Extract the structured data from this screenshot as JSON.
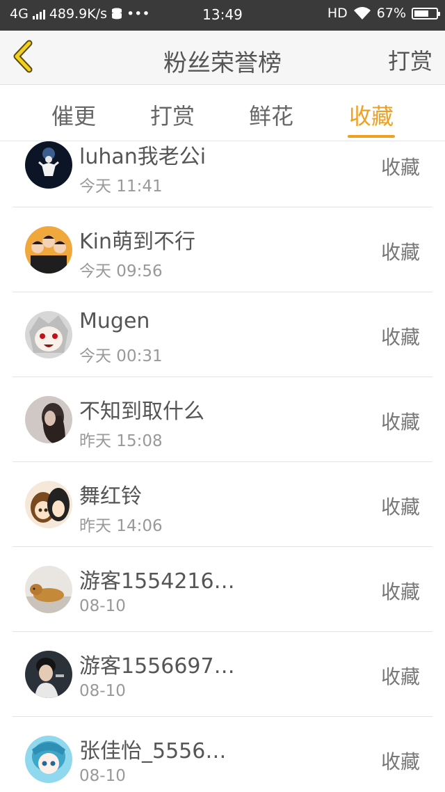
{
  "status_bar": {
    "network": "4G",
    "speed": "489.9K/s",
    "more": "•••",
    "time": "13:49",
    "hd": "HD",
    "battery": "67%",
    "battery_level": 0.67
  },
  "nav": {
    "title": "粉丝荣誉榜",
    "action": "打赏"
  },
  "tabs": [
    {
      "label": "催更",
      "active": false
    },
    {
      "label": "打赏",
      "active": false
    },
    {
      "label": "鲜花",
      "active": false
    },
    {
      "label": "收藏",
      "active": true
    }
  ],
  "accent_color": "#f0a020",
  "list": [
    {
      "name": "luhan我老公i",
      "time": "今天 11:41",
      "action": "收藏"
    },
    {
      "name": "Kin萌到不行",
      "time": "今天 09:56",
      "action": "收藏"
    },
    {
      "name": "Mugen",
      "time": "今天 00:31",
      "action": "收藏"
    },
    {
      "name": "不知到取什么",
      "time": "昨天 15:08",
      "action": "收藏"
    },
    {
      "name": "舞红铃",
      "time": "昨天 14:06",
      "action": "收藏"
    },
    {
      "name": "游客1554216…",
      "time": "08-10",
      "action": "收藏"
    },
    {
      "name": "游客1556697…",
      "time": "08-10",
      "action": "收藏"
    },
    {
      "name": "张佳怡_5556…",
      "time": "08-10",
      "action": "收藏"
    }
  ]
}
